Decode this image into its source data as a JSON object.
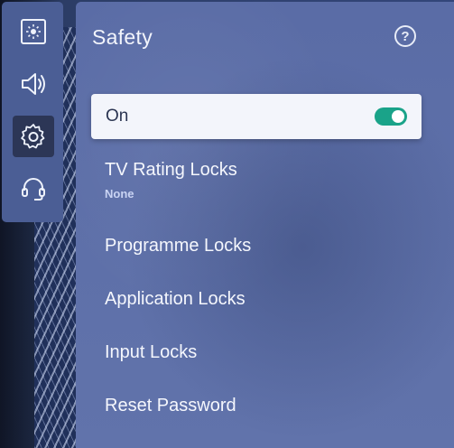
{
  "rail": {
    "items": [
      {
        "icon": "picture-icon"
      },
      {
        "icon": "speaker-icon"
      },
      {
        "icon": "gear-icon"
      },
      {
        "icon": "headset-icon"
      }
    ]
  },
  "panel": {
    "title": "Safety",
    "help_icon": "question-mark-icon",
    "toggle": {
      "label": "On",
      "state": "on",
      "color": "#1aa389"
    },
    "menu": [
      {
        "label": "TV Rating Locks",
        "value": "None"
      },
      {
        "label": "Programme Locks"
      },
      {
        "label": "Application Locks"
      },
      {
        "label": "Input Locks"
      },
      {
        "label": "Reset Password"
      }
    ]
  }
}
